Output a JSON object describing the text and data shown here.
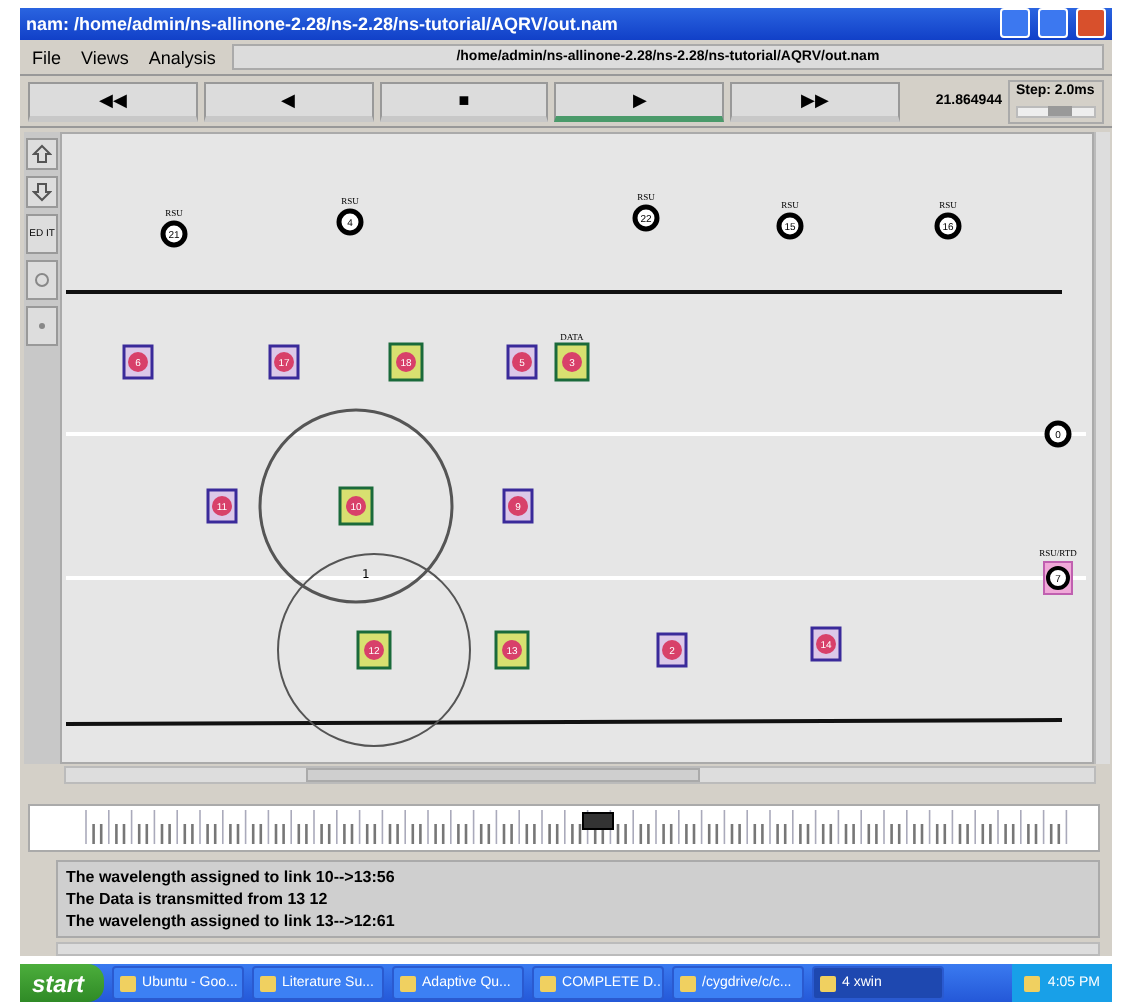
{
  "window": {
    "title": "nam: /home/admin/ns-allinone-2.28/ns-2.28/ns-tutorial/AQRV/out.nam"
  },
  "menu": [
    "File",
    "Views",
    "Analysis"
  ],
  "file_path": "/home/admin/ns-allinone-2.28/ns-2.28/ns-tutorial/AQRV/out.nam",
  "controls": [
    {
      "glyph": "◀◀",
      "selected": false
    },
    {
      "glyph": "◀",
      "selected": false
    },
    {
      "glyph": "■",
      "selected": false
    },
    {
      "glyph": "▶",
      "selected": true
    },
    {
      "glyph": "▶▶",
      "selected": false
    }
  ],
  "time": "21.864944",
  "step": {
    "label": "Step: 2.0ms",
    "level": 0.55
  },
  "side_tools": [
    {
      "kind": "zoom-in"
    },
    {
      "kind": "zoom-out"
    },
    {
      "kind": "edit",
      "label": "ED IT"
    },
    {
      "kind": "circle"
    },
    {
      "kind": "dot"
    }
  ],
  "nodes": [
    {
      "kind": "rsu",
      "label": "21",
      "tag": "RSU"
    },
    {
      "kind": "rsu",
      "label": "4",
      "tag": "RSU"
    },
    {
      "kind": "rsu",
      "label": "22",
      "tag": "RSU"
    },
    {
      "kind": "rsu",
      "label": "15",
      "tag": "RSU"
    },
    {
      "kind": "rsu",
      "label": "16",
      "tag": "RSU"
    },
    {
      "kind": "plain",
      "label": "6"
    },
    {
      "kind": "plain",
      "label": "17"
    },
    {
      "kind": "active",
      "label": "18"
    },
    {
      "kind": "plain",
      "label": "5"
    },
    {
      "kind": "active",
      "label": "3",
      "tag": "DATA"
    },
    {
      "kind": "rsu",
      "label": "0"
    },
    {
      "kind": "plain",
      "label": "11"
    },
    {
      "kind": "active",
      "label": "10"
    },
    {
      "kind": "plain",
      "label": "9"
    },
    {
      "kind": "pink",
      "label": "7",
      "tag": "RSU/RTD"
    },
    {
      "kind": "active",
      "label": "12"
    },
    {
      "kind": "active",
      "label": "13"
    },
    {
      "kind": "plain",
      "label": "2"
    },
    {
      "kind": "plain",
      "label": "14"
    }
  ],
  "range_label": "1",
  "timeline": {
    "level": 0.53
  },
  "log": [
    "The wavelength assigned to link 10-->13:56",
    "The Data is transmitted from 13 12",
    "The wavelength assigned to link 13-->12:61"
  ],
  "taskbar": {
    "start": "start",
    "items": [
      {
        "label": "Ubuntu - Goo...",
        "selected": false
      },
      {
        "label": "Literature Su...",
        "selected": false
      },
      {
        "label": "Adaptive Qu...",
        "selected": false
      },
      {
        "label": "COMPLETE D...",
        "selected": false
      },
      {
        "label": "/cygdrive/c/c...",
        "selected": false
      },
      {
        "label": "4 xwin",
        "selected": true
      }
    ],
    "clock": "4:05 PM"
  }
}
